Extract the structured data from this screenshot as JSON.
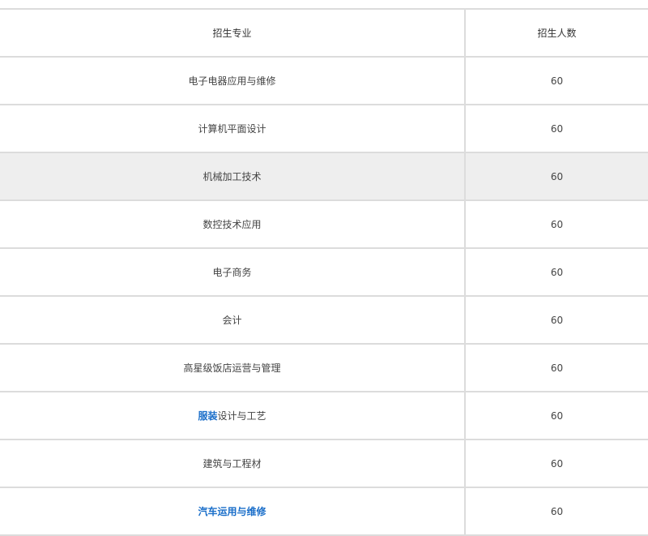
{
  "table": {
    "headers": {
      "major": "招生专业",
      "count": "招生人数"
    },
    "rows": [
      {
        "major": "电子电器应用与维修",
        "count": "60"
      },
      {
        "major": "计算机平面设计",
        "count": "60"
      },
      {
        "major": "机械加工技术",
        "count": "60"
      },
      {
        "major": "数控技术应用",
        "count": "60"
      },
      {
        "major": "电子商务",
        "count": "60"
      },
      {
        "major": "会计",
        "count": "60"
      },
      {
        "major": "高星级饭店运营与管理",
        "count": "60"
      },
      {
        "major_link": "服装",
        "major_rest": "设计与工艺",
        "count": "60"
      },
      {
        "major": "建筑与工程材",
        "count": "60"
      },
      {
        "major_link": "汽车运用与维修",
        "count": "60"
      }
    ]
  },
  "colors": {
    "link": "#1a6ec9",
    "highlight_row": "#eeeeee",
    "border": "#dcdcdc"
  }
}
